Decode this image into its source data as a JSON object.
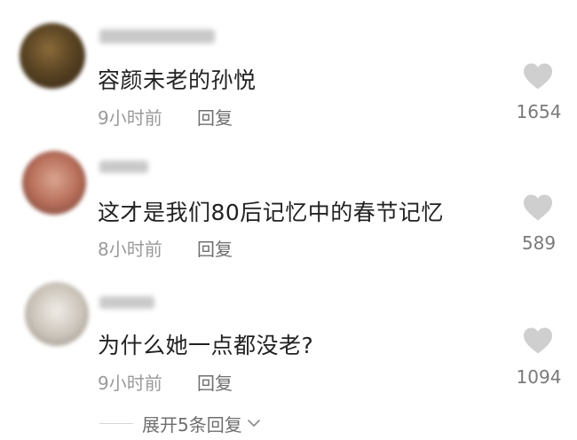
{
  "comments": [
    {
      "text": "容颜未老的孙悦",
      "time": "9小时前",
      "reply_label": "回复",
      "likes": "1654"
    },
    {
      "text": "这才是我们80后记忆中的春节记忆",
      "time": "8小时前",
      "reply_label": "回复",
      "likes": "589"
    },
    {
      "text": "为什么她一点都没老?",
      "time": "9小时前",
      "reply_label": "回复",
      "likes": "1094"
    }
  ],
  "expand_replies_label": "展开5条回复",
  "colors": {
    "text": "#222222",
    "muted": "#9a9a9a",
    "like_icon": "#cfcfcf"
  },
  "icons": [
    "heart-icon",
    "chevron-down-icon"
  ]
}
